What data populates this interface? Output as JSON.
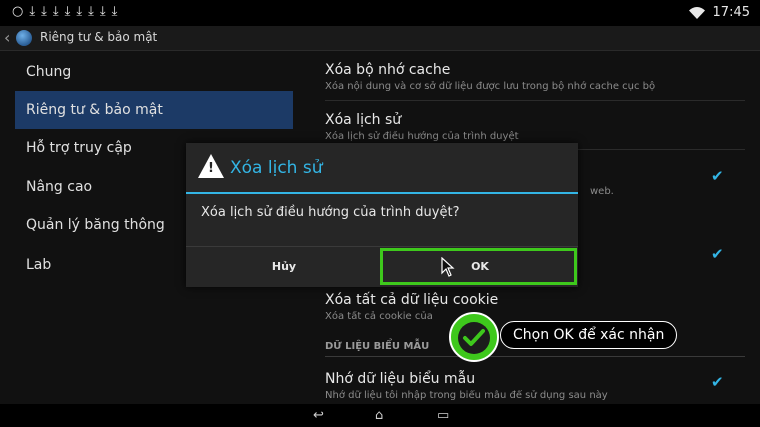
{
  "status_bar": {
    "notification_icons": [
      "circle-icon",
      "download-icon",
      "download-icon",
      "download-icon",
      "download-icon",
      "download-icon",
      "download-icon",
      "download-icon",
      "download-icon"
    ],
    "time": "17:45"
  },
  "action_bar": {
    "title": "Riêng tư & bảo mật"
  },
  "left_menu": {
    "items": [
      {
        "label": "Chung"
      },
      {
        "label": "Riêng tư & bảo mật",
        "active": true
      },
      {
        "label": "Hỗ trợ truy cập"
      },
      {
        "label": "Nâng cao"
      },
      {
        "label": "Quản lý băng thông"
      },
      {
        "label": "Lab"
      }
    ]
  },
  "prefs": {
    "clear_cache": {
      "title": "Xóa bộ nhớ cache",
      "summary": "Xóa nội dung và cơ sở dữ liệu được lưu trong bộ nhớ cache cục bộ"
    },
    "clear_history": {
      "title": "Xóa lịch sử",
      "summary": "Xóa lịch sử điều hướng của trình duyệt"
    },
    "pref3_summary_tail": "web.",
    "clear_cookies": {
      "title": "Xóa tất cả dữ liệu cookie",
      "summary": "Xóa tất cả cookie của"
    },
    "form_section": "DỮ LIỆU BIỂU MẪU",
    "remember_form": {
      "title": "Nhớ dữ liệu biểu mẫu",
      "summary": "Nhớ dữ liệu tôi nhập trong biểu mẫu để sử dụng sau này"
    }
  },
  "dialog": {
    "title": "Xóa lịch sử",
    "message": "Xóa lịch sử điều hướng của trình duyệt?",
    "cancel_label": "Hủy",
    "ok_label": "OK"
  },
  "callout": {
    "label": "Chọn OK để xác nhận"
  },
  "colors": {
    "accent": "#33b5e5",
    "highlight": "#3ec81c",
    "selected_item": "#1c3a66"
  }
}
